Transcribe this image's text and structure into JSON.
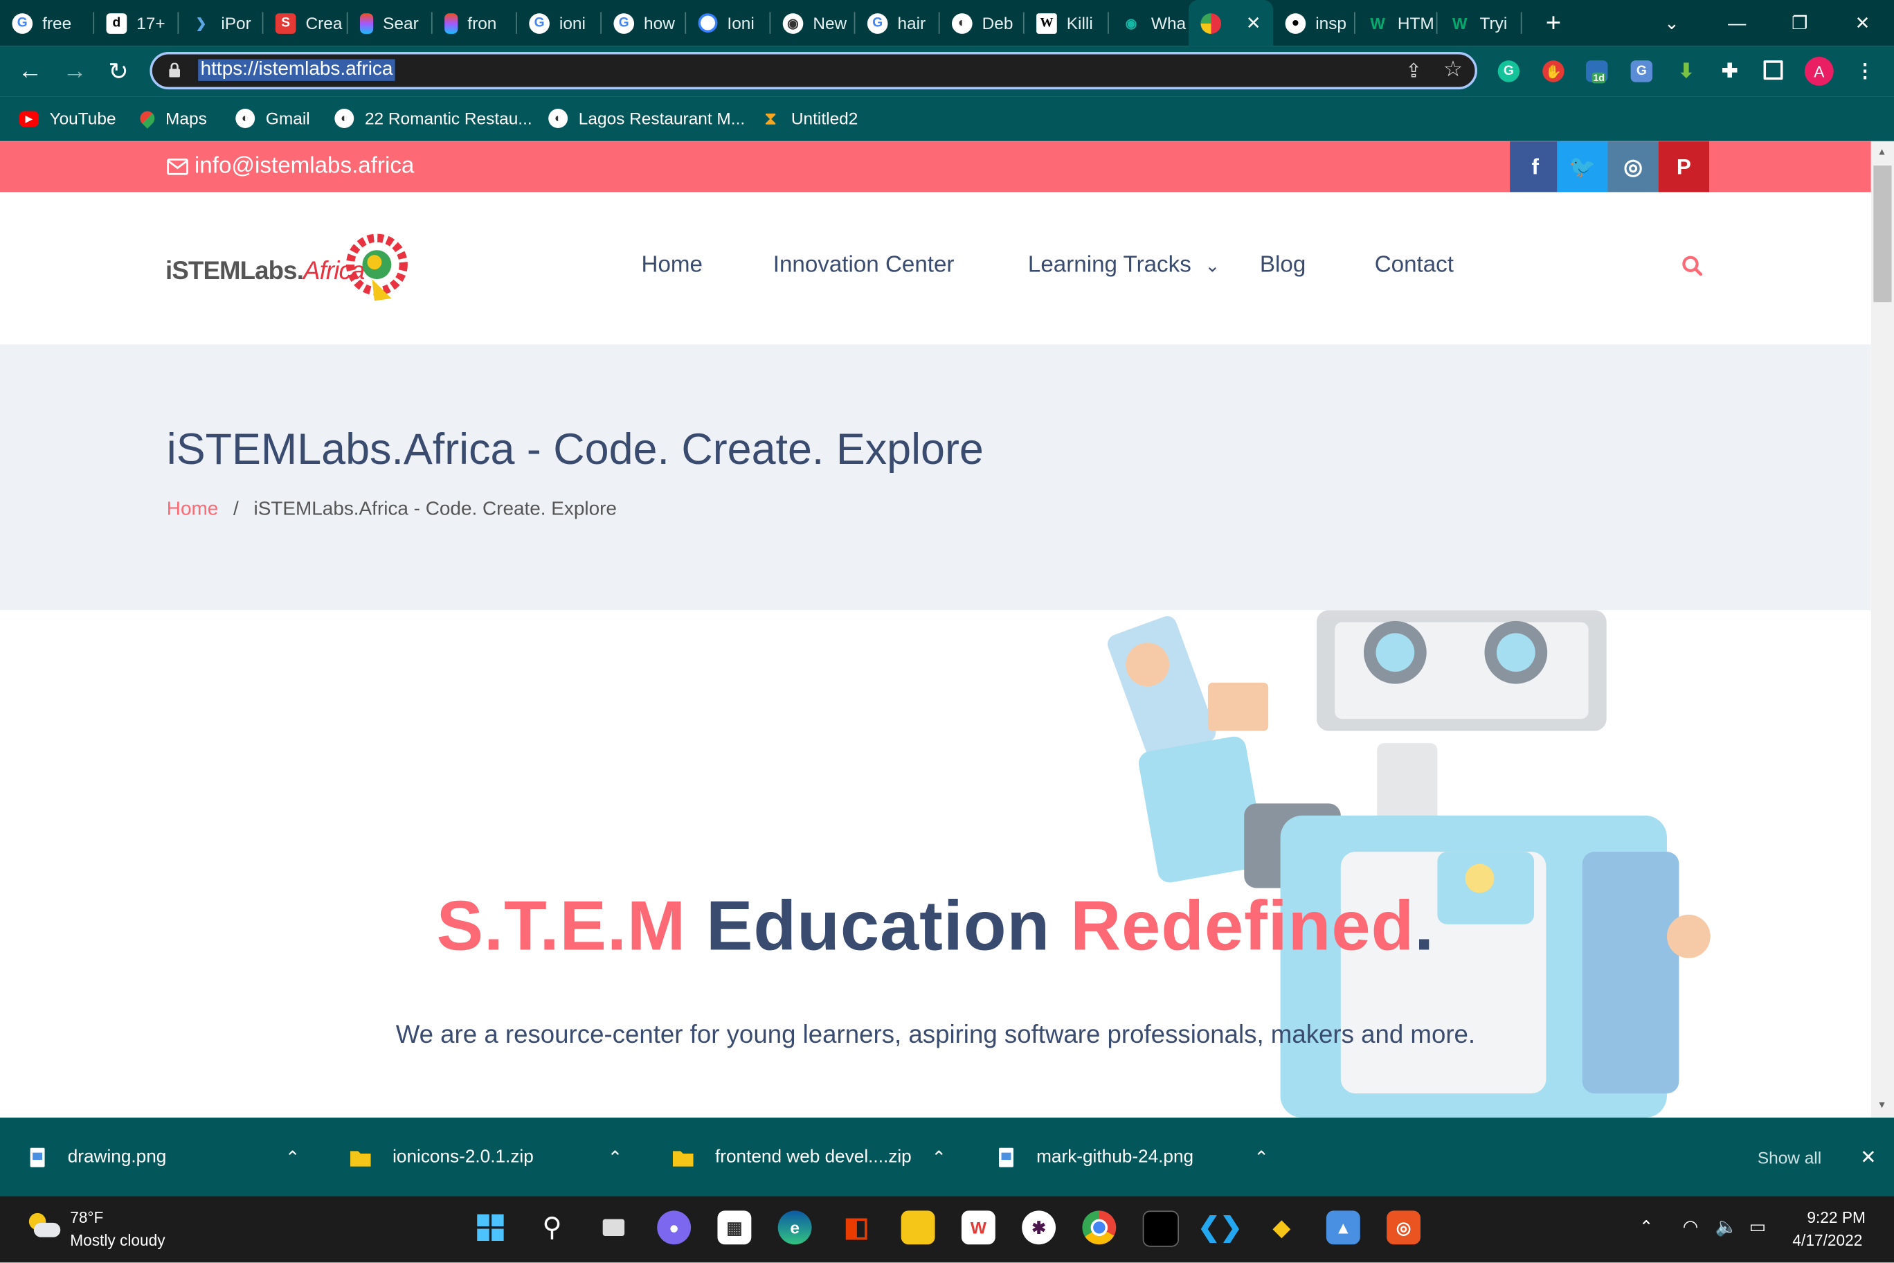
{
  "browser": {
    "tabs": [
      {
        "label": "free",
        "icon": "google-icon"
      },
      {
        "label": "17+",
        "icon": "dev-icon"
      },
      {
        "label": "iPor",
        "icon": "ipor-icon"
      },
      {
        "label": "Crea",
        "icon": "s-icon"
      },
      {
        "label": "Sear",
        "icon": "figma-icon"
      },
      {
        "label": "fron",
        "icon": "figma-icon"
      },
      {
        "label": "ioni",
        "icon": "google-icon"
      },
      {
        "label": "how",
        "icon": "google-icon"
      },
      {
        "label": "Ioni",
        "icon": "ionic-icon"
      },
      {
        "label": "New",
        "icon": "chrome-icon"
      },
      {
        "label": "hair",
        "icon": "google-icon"
      },
      {
        "label": "Deb",
        "icon": "globe-icon"
      },
      {
        "label": "Killi",
        "icon": "wikipedia-icon"
      },
      {
        "label": "Wha",
        "icon": "eye-icon"
      },
      {
        "label": "",
        "icon": "istemlabs-icon",
        "active": true
      },
      {
        "label": "insp",
        "icon": "github-icon"
      },
      {
        "label": "HTM",
        "icon": "w3-icon"
      },
      {
        "label": "Tryi",
        "icon": "w3-icon"
      }
    ],
    "url": "https://istemlabs.africa",
    "bookmarks": [
      {
        "label": "YouTube",
        "icon": "youtube-icon"
      },
      {
        "label": "Maps",
        "icon": "maps-icon"
      },
      {
        "label": "Gmail",
        "icon": "globe-icon"
      },
      {
        "label": "22 Romantic Restau...",
        "icon": "globe-icon"
      },
      {
        "label": "Lagos Restaurant M...",
        "icon": "globe-icon"
      },
      {
        "label": "Untitled2",
        "icon": "hourglass-icon"
      }
    ],
    "profile_initial": "A",
    "extension_badge": "1d"
  },
  "site": {
    "email": "info@istemlabs.africa",
    "social": [
      {
        "name": "facebook",
        "glyph": "f",
        "color": "#3b5998"
      },
      {
        "name": "twitter",
        "glyph": "t",
        "color": "#1da1f2"
      },
      {
        "name": "instagram",
        "glyph": "◎",
        "color": "#517fa4"
      },
      {
        "name": "pinterest",
        "glyph": "P",
        "color": "#cb2027"
      }
    ],
    "logo": {
      "main": "iSTEMLabs.",
      "accent": "Africa"
    },
    "menu": [
      "Home",
      "Innovation Center",
      "Learning Tracks",
      "Blog",
      "Contact"
    ],
    "page_title": "iSTEMLabs.Africa - Code. Create. Explore",
    "breadcrumb": {
      "home": "Home",
      "separator": "/",
      "current": "iSTEMLabs.Africa - Code. Create. Explore"
    },
    "hero": {
      "word1": "S.T.E.M",
      "word2": "Education",
      "word3": "Redefined",
      "dot": ".",
      "subtitle": "We are a resource-center for young learners, aspiring software professionals, makers and more."
    },
    "accent_color": "#fd6974",
    "navy_color": "#3a4b70"
  },
  "downloads": {
    "items": [
      "drawing.png",
      "ionicons-2.0.1.zip",
      "frontend web devel....zip",
      "mark-github-24.png"
    ],
    "show_all": "Show all"
  },
  "taskbar": {
    "weather_temp": "78°F",
    "weather_desc": "Mostly cloudy",
    "time": "9:22 PM",
    "date": "4/17/2022"
  }
}
